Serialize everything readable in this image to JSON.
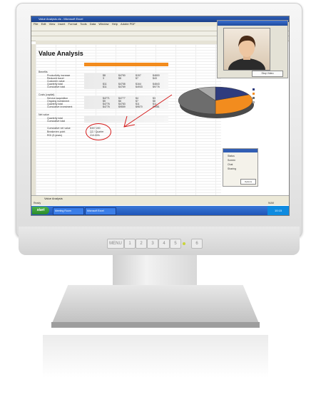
{
  "window": {
    "title": "Value Analysis.xls - Microsoft Excel"
  },
  "menu": [
    "File",
    "Edit",
    "View",
    "Insert",
    "Format",
    "Tools",
    "Data",
    "Window",
    "Help",
    "Adobe PDF"
  ],
  "sheet": {
    "heading": "Value Analysis",
    "sections": [
      {
        "title": "Benefits",
        "rows": [
          {
            "label": "Productivity increase",
            "values": [
              "$8",
              "$4750",
              "$157",
              "$4800"
            ]
          },
          {
            "label": "Reduced travel",
            "values": [
              "3",
              "$8",
              "$7",
              "$43"
            ]
          },
          {
            "label": "Customer value",
            "values": [
              "",
              "",
              "",
              ""
            ]
          },
          {
            "label": "Quarterly total",
            "values": [
              "$11",
              "$4758",
              "$164",
              "$4843"
            ]
          },
          {
            "label": "Cumulative total",
            "values": [
              "$11",
              "$4769",
              "$4933",
              "$9776"
            ]
          }
        ]
      },
      {
        "title": "Costs (capital)",
        "rows": [
          {
            "label": "Service acquisition",
            "values": [
              "$4771",
              "$4777",
              "$4",
              "$3"
            ]
          },
          {
            "label": "Ongoing investment",
            "values": [
              "$5",
              "$6",
              "$7",
              "$8"
            ]
          },
          {
            "label": "Quarterly total",
            "values": [
              "$4776",
              "$4783",
              "$11",
              "$11"
            ]
          },
          {
            "label": "Cumulative investment",
            "values": [
              "$4776",
              "$9559",
              "$9570",
              "$9581"
            ]
          }
        ]
      },
      {
        "title": "Net value",
        "rows": [
          {
            "label": "Quarterly total",
            "values": [
              "",
              "",
              "",
              ""
            ]
          },
          {
            "label": "Cumulative total",
            "values": [
              "",
              "",
              "",
              ""
            ]
          }
        ]
      }
    ],
    "summary": [
      {
        "label": "Cumulative net value",
        "value": "$307,000"
      },
      {
        "label": "Breakeven point",
        "value": "Q2 / Quarter"
      },
      {
        "label": "ROI (5 years)",
        "value": "210.00%"
      }
    ],
    "tab": "Value Analysis"
  },
  "chart_data": {
    "type": "pie",
    "labels": [
      "Slice 1",
      "Slice 2",
      "Slice 3",
      "Slice 4"
    ],
    "values": [
      18,
      32,
      42,
      8
    ],
    "colors": [
      "#2f3c7e",
      "#f28c1e",
      "#6d6d6d",
      "#a9a9a9"
    ]
  },
  "video": {
    "hangup_label": "Stop Video"
  },
  "panel": {
    "items": [
      "Status",
      "Screen",
      "Chat",
      "Sharing"
    ],
    "button": "Options"
  },
  "status": {
    "left": "Ready",
    "right": "NUM"
  },
  "taskbar": {
    "start": "start",
    "tasks": [
      "Meeting Room",
      "Microsoft Excel"
    ],
    "time": "10:15"
  },
  "monitor": {
    "buttons": [
      "MENU",
      "1",
      "2",
      "3",
      "4",
      "5",
      "6"
    ]
  }
}
